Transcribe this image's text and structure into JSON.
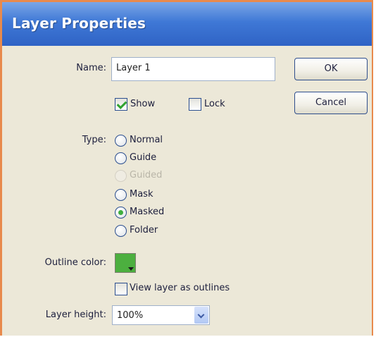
{
  "window": {
    "title": "Layer Properties"
  },
  "name": {
    "label": "Name:",
    "value": "Layer 1"
  },
  "buttons": {
    "ok": "OK",
    "cancel": "Cancel"
  },
  "checkboxes": {
    "show": {
      "label": "Show",
      "checked": true
    },
    "lock": {
      "label": "Lock",
      "checked": false
    },
    "outlines": {
      "label": "View layer as outlines",
      "checked": false
    }
  },
  "type": {
    "label": "Type:",
    "options": [
      {
        "label": "Normal",
        "checked": false,
        "disabled": false
      },
      {
        "label": "Guide",
        "checked": false,
        "disabled": false
      },
      {
        "label": "Guided",
        "checked": false,
        "disabled": true
      },
      {
        "label": "Mask",
        "checked": false,
        "disabled": false
      },
      {
        "label": "Masked",
        "checked": true,
        "disabled": false
      },
      {
        "label": "Folder",
        "checked": false,
        "disabled": false
      }
    ]
  },
  "outline_color": {
    "label": "Outline color:",
    "color": "#4caf3f"
  },
  "layer_height": {
    "label": "Layer height:",
    "value": "100%"
  }
}
